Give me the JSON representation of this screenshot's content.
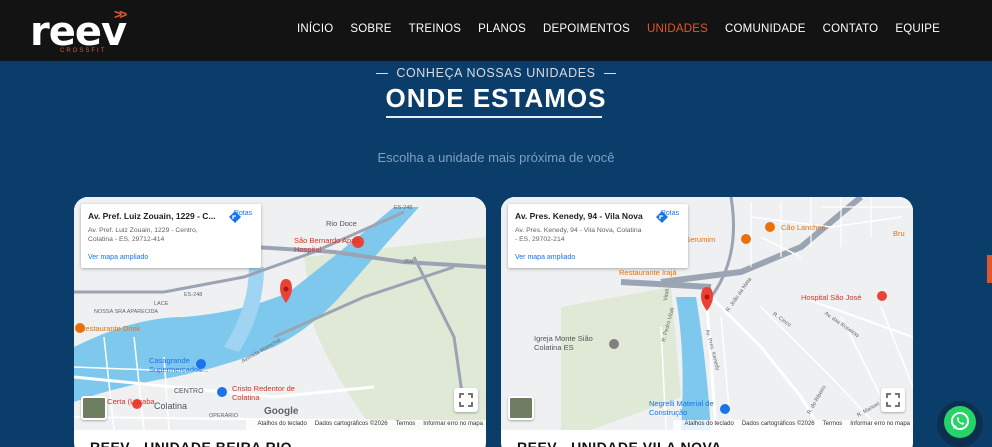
{
  "header": {
    "logo_word": "reev",
    "logo_sub": "CROSSFIT",
    "nav": [
      "INÍCIO",
      "SOBRE",
      "TREINOS",
      "PLANOS",
      "DEPOIMENTOS",
      "UNIDADES",
      "COMUNIDADE",
      "CONTATO",
      "EQUIPE"
    ],
    "active_nav": "UNIDADES"
  },
  "section": {
    "eyebrow": "CONHEÇA NOSSAS UNIDADES",
    "title": "ONDE ESTAMOS",
    "subtitle": "Escolha a unidade mais próxima de você"
  },
  "cards": [
    {
      "map": {
        "place_name": "Av. Pref. Luiz Zouain, 1229 - C...",
        "address": "Av. Pref. Luiz Zouain, 1229 - Centro, Colatina - ES, 29712-414",
        "route_label": "Rotas",
        "link": "Ver mapa ampliado",
        "labels": {
          "rio_doce_top": "Rio Doce",
          "rio_doce_river": "Rio Doce",
          "es248_top": "ES-248",
          "es248_left": "ES-248",
          "br259": "259",
          "hospital": "São Bernardo Apart Hospital",
          "restaurant": "Restaurante Drink",
          "nossa": "NOSSA SRA APARECIDA",
          "lace": "LACE",
          "casagrande": "Casagrande Supermercados...",
          "cristo": "Cristo Redentor de Colatina",
          "centro": "CENTRO",
          "colatina": "Colatina",
          "operario": "OPERÁRIO",
          "avenue": "Avenida Marechal...",
          "market": "mpra Certa (Luxaba"
        },
        "google": "Google",
        "attribution": [
          "Atalhos do teclado",
          "Dados cartográficos ©2026",
          "Termos",
          "Informar erro no mapa"
        ]
      },
      "title": "REEV - UNIDADE BEIRA RIO"
    },
    {
      "map": {
        "place_name": "Av. Pres. Kenedy, 94 - Vila Nova",
        "address": "Av. Pres. Kenedy, 94 - Vila Nova, Colatina - ES, 29702-214",
        "route_label": "Rotas",
        "link": "Ver mapa ampliado",
        "labels": {
          "gerumim": "do Gerumim",
          "cao": "Cão Lanches",
          "irajá": "Restaurante Irajá",
          "hospital": "Hospital São José",
          "igreja": "Igreja Monte Sião Colatina ES",
          "negrelli": "Negrelli Material de Construção",
          "kenedy": "Av. Pres. Kenedy",
          "joao": "R. João da Mata",
          "pedro": "R. Pedro Vitali",
          "roseiras": "Av. das Roseiras",
          "cinco": "R. Cinco",
          "ribeiro": "R. do Ribeiro",
          "manoel": "R. Manoel",
          "vitali": "Vitali",
          "bru": "Bru"
        },
        "attribution": [
          "Atalhos do teclado",
          "Dados cartográficos ©2026",
          "Termos",
          "Informar erro no mapa"
        ]
      },
      "title": "REEV - UNIDADE VILA NOVA"
    }
  ],
  "colors": {
    "header_bg": "#131313",
    "accent": "#e2562e",
    "section_bg": "#0b3d6b",
    "whatsapp": "#25d366"
  },
  "icons": [
    "route-icon",
    "fullscreen-icon",
    "map-pin-icon",
    "whatsapp-icon"
  ]
}
